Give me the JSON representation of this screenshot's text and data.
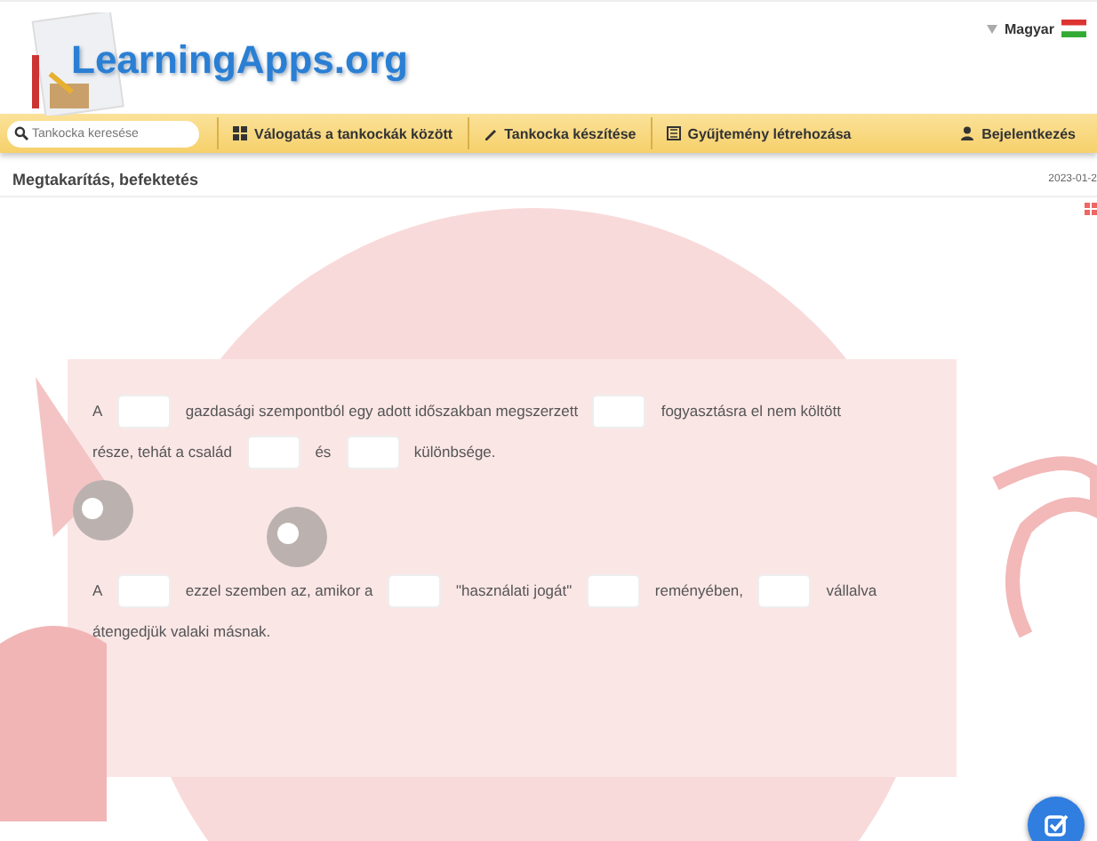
{
  "header": {
    "logo": "LearningApps.org",
    "language": "Magyar"
  },
  "nav": {
    "search": {
      "placeholder": "Tankocka keresése"
    },
    "items": [
      {
        "kind": "grid",
        "label": "Válogatás a tankockák között"
      },
      {
        "kind": "pencil",
        "label": "Tankocka készítése"
      },
      {
        "kind": "collection",
        "label": "Gyűjtemény létrehozása"
      },
      {
        "kind": "user",
        "label": "Bejelentkezés"
      }
    ]
  },
  "app": {
    "title": "Megtakarítás, befektetés",
    "date": "2023-01-2"
  },
  "paragraphs": [
    [
      {
        "kind": "text",
        "text": "A"
      },
      {
        "kind": "blank"
      },
      {
        "kind": "text",
        "text": "gazdasági szempontból egy adott időszakban megszerzett"
      },
      {
        "kind": "blank"
      },
      {
        "kind": "text",
        "text": "fogyasztásra el nem költött"
      },
      {
        "kind": "text",
        "text": "része, tehát a család"
      },
      {
        "kind": "blank"
      },
      {
        "kind": "text",
        "text": "és"
      },
      {
        "kind": "blank"
      },
      {
        "kind": "text",
        "text": "különbsége."
      }
    ],
    [
      {
        "kind": "text",
        "text": "A"
      },
      {
        "kind": "blank"
      },
      {
        "kind": "text",
        "text": "ezzel szemben az, amikor a"
      },
      {
        "kind": "blank"
      },
      {
        "kind": "text",
        "text": "\"használati jogát\""
      },
      {
        "kind": "blank"
      },
      {
        "kind": "text",
        "text": "reményében,"
      },
      {
        "kind": "blank"
      },
      {
        "kind": "text",
        "text": "vállalva"
      },
      {
        "kind": "text",
        "text": "átengedjük valaki másnak."
      }
    ]
  ]
}
